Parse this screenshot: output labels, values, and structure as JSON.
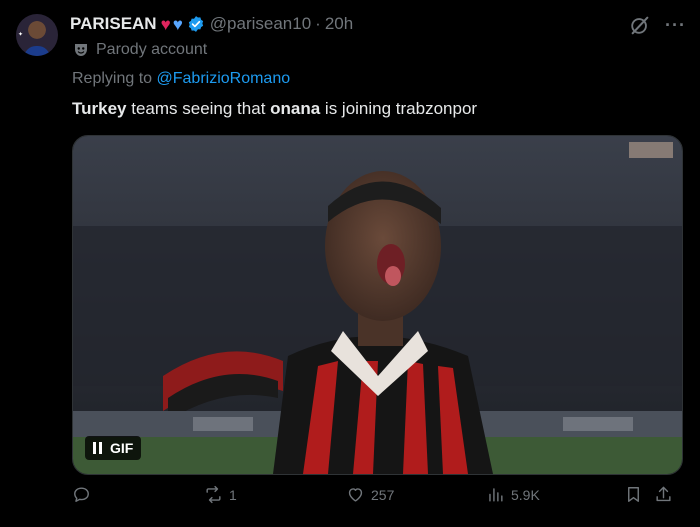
{
  "author": {
    "display_name": "PARISEAN",
    "handle": "@parisean10",
    "separator": "·",
    "time": "20h",
    "hearts": [
      "red-heart-icon",
      "blue-heart-icon"
    ],
    "verified": true,
    "label": "Parody account"
  },
  "reply": {
    "prefix": "Replying to ",
    "to": "@FabrizioRomano"
  },
  "text": {
    "part1_bold": "Turkey",
    "part2": " teams seeing that ",
    "part3_bold": "onana",
    "part4": " is joining trabzonpor"
  },
  "media": {
    "type": "gif",
    "badge_label": "GIF",
    "state": "paused-control-visible"
  },
  "actions": {
    "reply_count": "",
    "repost_count": "1",
    "like_count": "257",
    "view_count": "5.9K"
  },
  "colors": {
    "background": "#000000",
    "text": "#e7e9ea",
    "muted": "#71767b",
    "link": "#1d9bf0",
    "verified": "#1d9bf0",
    "heart_red": "#e0245e",
    "heart_blue": "#58a6ff"
  }
}
